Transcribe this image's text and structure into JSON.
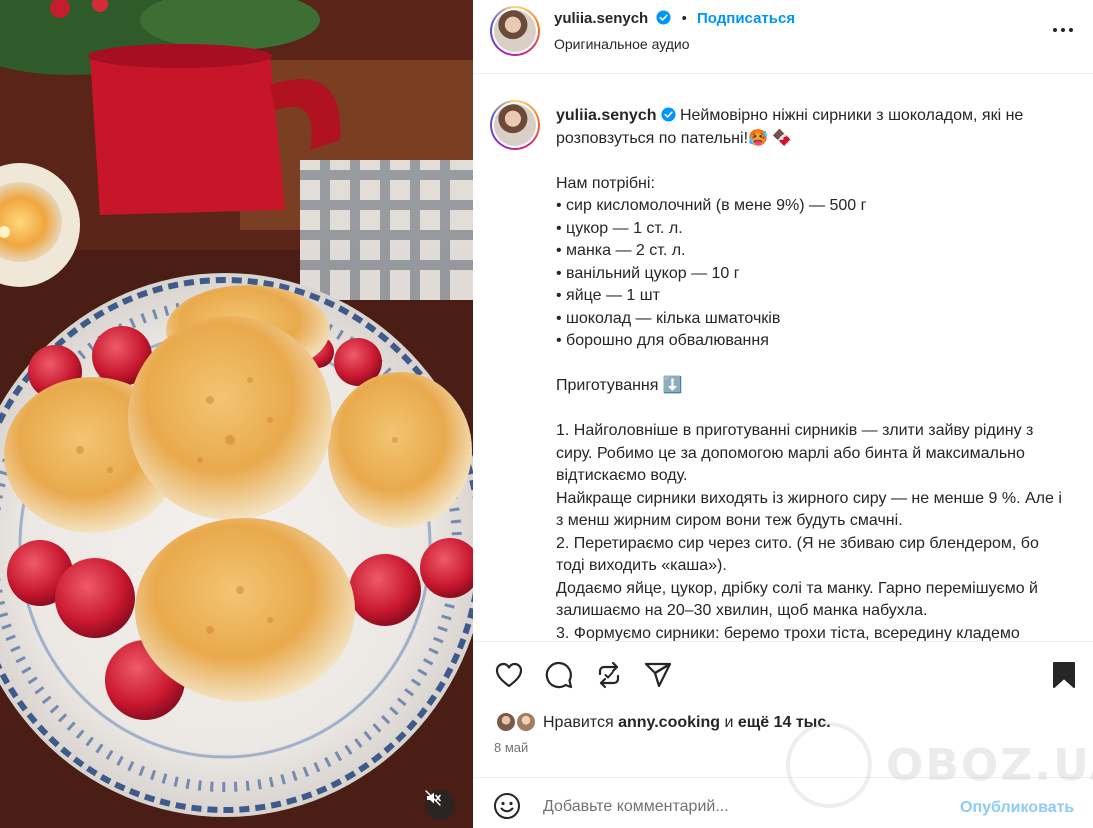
{
  "header": {
    "username": "yuliia.senych",
    "separator": "•",
    "follow_label": "Подписаться",
    "audio_label": "Оригинальное аудио"
  },
  "caption": {
    "username": "yuliia.senych",
    "text": "Неймовірно ніжні сирники з шоколадом, які не розповзуться по пательні!🥵 🍫\n\nНам потрібні:\n• сир кисломолочний (в мене 9%) — 500 г\n• цукор — 1 ст. л.\n• манка — 2 ст. л.\n• ванільний цукор — 10 г\n• яйце — 1 шт\n• шоколад — кілька шматочків\n• борошно для обвалювання\n\nПриготування ⬇️\n\n1. Найголовніше в приготуванні сирників — злити зайву рідину з сиру. Робимо це за допомогою марлі або бинта й максимально відтискаємо воду.\nНайкраще сирники виходять із жирного сиру — не менше 9 %. Але і з менш жирним сиром вони теж будуть смачні.\n2. Перетираємо сир через сито. (Я не збиваю сир блендером, бо тоді виходить «каша»).\nДодаємо яйце, цукор, дрібку солі та манку. Гарно перемішуємо й залишаємо на 20–30 хвилин, щоб манка набухла.\n3. Формуємо сирники: беремо трохи тіста, всередину кладемо"
  },
  "likes": {
    "prefix": "Нравится",
    "liker_name": "anny.cooking",
    "conjunction": "и",
    "others": "ещё 14 тыс."
  },
  "date": "8 май",
  "comment": {
    "placeholder": "Добавьте комментарий...",
    "publish_label": "Опубликовать"
  },
  "watermark": {
    "text": "OBOZ.UA"
  },
  "colors": {
    "link_blue": "#0095f6",
    "publish_disabled": "#8ecbf6",
    "verified": "#0095f6"
  },
  "icons": [
    "verified-icon",
    "more-icon",
    "like-icon",
    "comment-icon",
    "repost-icon",
    "share-icon",
    "save-icon",
    "emoji-icon",
    "mute-icon"
  ]
}
